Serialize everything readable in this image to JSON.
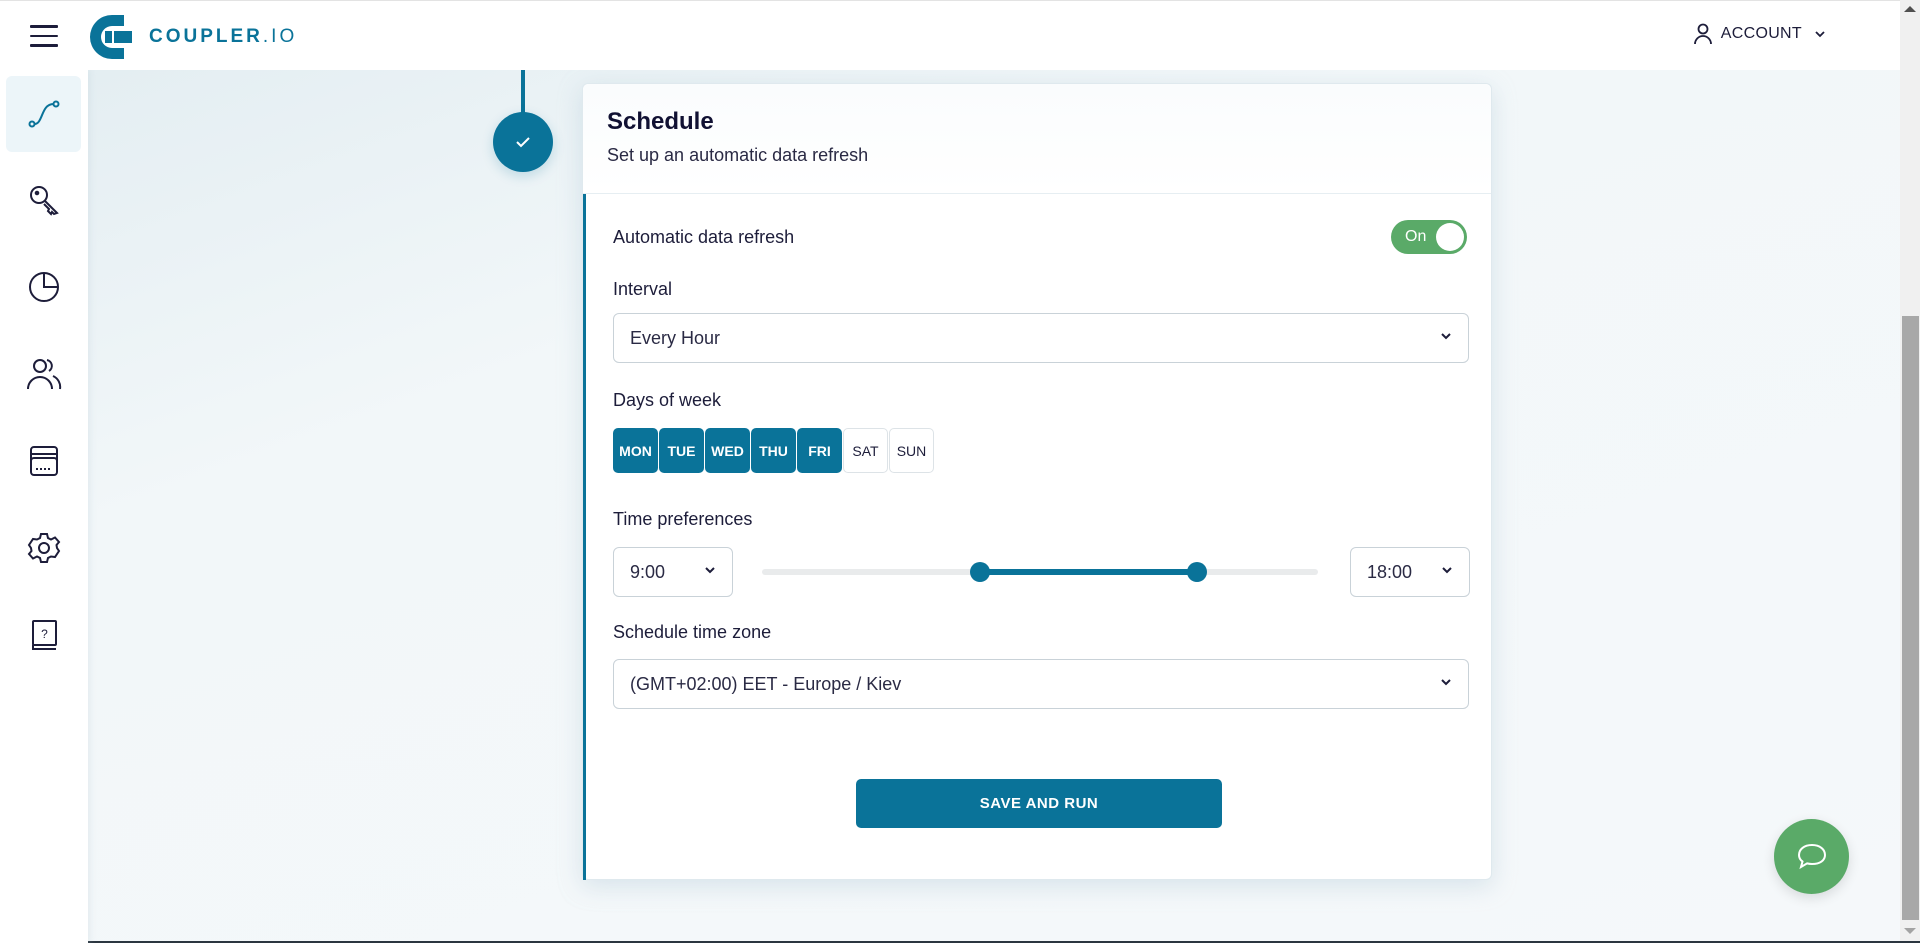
{
  "header": {
    "menu_icon": "hamburger-menu-icon",
    "logo_text_main": "COUPLER",
    "logo_text_suffix": ".IO",
    "account_label": "ACCOUNT",
    "account_icon": "user-icon"
  },
  "sidebar": {
    "items": [
      {
        "name": "dataflows",
        "icon": "flow-path-icon",
        "active": true
      },
      {
        "name": "connections",
        "icon": "key-icon",
        "active": false
      },
      {
        "name": "analytics",
        "icon": "pie-chart-icon",
        "active": false
      },
      {
        "name": "team",
        "icon": "users-icon",
        "active": false
      },
      {
        "name": "billing",
        "icon": "credit-card-icon",
        "active": false
      },
      {
        "name": "settings",
        "icon": "gear-icon",
        "active": false
      },
      {
        "name": "help",
        "icon": "help-book-icon",
        "active": false
      }
    ]
  },
  "step": {
    "status": "completed",
    "icon": "checkmark-icon"
  },
  "schedule": {
    "title": "Schedule",
    "subtitle": "Set up an automatic data refresh",
    "auto_refresh_label": "Automatic data refresh",
    "auto_refresh_toggle": "On",
    "auto_refresh_enabled": true,
    "interval_label": "Interval",
    "interval_value": "Every Hour",
    "days_label": "Days of week",
    "days": [
      {
        "label": "MON",
        "selected": true
      },
      {
        "label": "TUE",
        "selected": true
      },
      {
        "label": "WED",
        "selected": true
      },
      {
        "label": "THU",
        "selected": true
      },
      {
        "label": "FRI",
        "selected": true
      },
      {
        "label": "SAT",
        "selected": false
      },
      {
        "label": "SUN",
        "selected": false
      }
    ],
    "time_label": "Time preferences",
    "time_from": "9:00",
    "time_to": "18:00",
    "time_range_hours": {
      "min": 0,
      "max": 23,
      "from": 9,
      "to": 18
    },
    "timezone_label": "Schedule time zone",
    "timezone_value": "(GMT+02:00) EET - Europe / Kiev",
    "save_button": "SAVE AND RUN"
  },
  "chat": {
    "icon": "chat-bubble-icon"
  },
  "colors": {
    "brand": "#0a7399",
    "toggle_on": "#5aaa68",
    "chat": "#5aaa68"
  }
}
